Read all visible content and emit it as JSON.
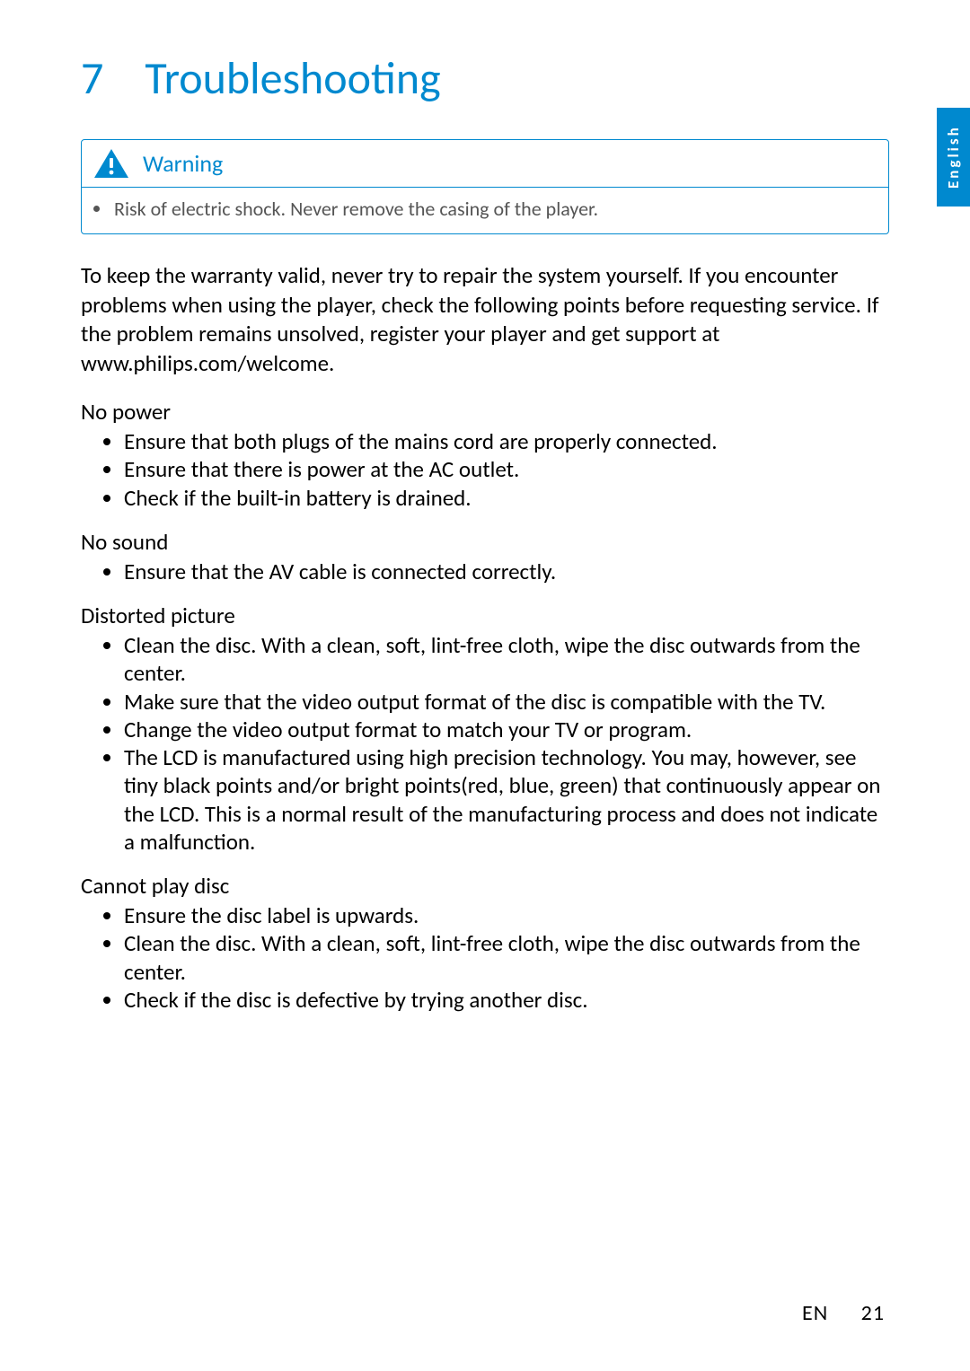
{
  "language_tab": "English",
  "chapter": {
    "number": "7",
    "title": "Troubleshooting"
  },
  "warning": {
    "label": "Warning",
    "items": [
      "Risk of electric shock. Never remove the casing of the player."
    ]
  },
  "intro": "To keep the warranty valid, never try to repair the system yourself. If you encounter problems when using the player, check the following points before requesting service. If the problem remains unsolved, register your player and get support at www.philips.com/welcome.",
  "sections": [
    {
      "heading": "No power",
      "items": [
        "Ensure that both plugs of the mains cord are properly connected.",
        "Ensure that there is power at the AC outlet.",
        "Check if the built-in battery is drained."
      ]
    },
    {
      "heading": "No sound",
      "items": [
        "Ensure that the AV cable is connected correctly."
      ]
    },
    {
      "heading": "Distorted picture",
      "items": [
        "Clean the disc. With a clean, soft, lint-free cloth, wipe the disc outwards from the center.",
        "Make sure that the video output format of the disc is compatible with the TV.",
        "Change the video output format to match your TV or program.",
        "The LCD is manufactured using high precision technology. You may, however, see tiny black points and/or bright points(red, blue, green) that continuously appear on the LCD. This is a normal result of the manufacturing process and does not indicate a malfunction."
      ]
    },
    {
      "heading": "Cannot play disc",
      "items": [
        "Ensure the disc label is upwards.",
        "Clean the disc. With a clean, soft, lint-free cloth, wipe the disc outwards from the center.",
        "Check if the disc is defective by trying another disc."
      ]
    }
  ],
  "footer": {
    "lang_code": "EN",
    "page_number": "21"
  }
}
